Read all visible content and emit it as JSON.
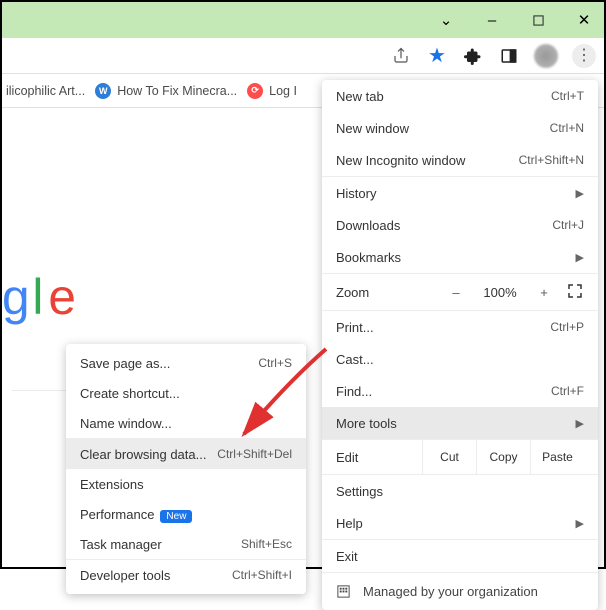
{
  "window": {
    "minimize": "–",
    "maximize": "▢",
    "close": "✕",
    "chevron": "⌄"
  },
  "bookmarks": {
    "item1": "ilicophilic Art...",
    "item2": "How To Fix Minecra...",
    "item3": "Log I"
  },
  "menu": {
    "newtab": {
      "label": "New tab",
      "shortcut": "Ctrl+T"
    },
    "newwindow": {
      "label": "New window",
      "shortcut": "Ctrl+N"
    },
    "incognito": {
      "label": "New Incognito window",
      "shortcut": "Ctrl+Shift+N"
    },
    "history": {
      "label": "History"
    },
    "downloads": {
      "label": "Downloads",
      "shortcut": "Ctrl+J"
    },
    "bookmarks": {
      "label": "Bookmarks"
    },
    "zoom": {
      "label": "Zoom",
      "minus": "–",
      "pct": "100%",
      "plus": "+"
    },
    "print": {
      "label": "Print...",
      "shortcut": "Ctrl+P"
    },
    "cast": {
      "label": "Cast..."
    },
    "find": {
      "label": "Find...",
      "shortcut": "Ctrl+F"
    },
    "moretools": {
      "label": "More tools"
    },
    "edit": {
      "label": "Edit",
      "cut": "Cut",
      "copy": "Copy",
      "paste": "Paste"
    },
    "settings": {
      "label": "Settings"
    },
    "help": {
      "label": "Help"
    },
    "exit": {
      "label": "Exit"
    },
    "managed": {
      "label": "Managed by your organization"
    }
  },
  "submenu": {
    "savepage": {
      "label": "Save page as...",
      "shortcut": "Ctrl+S"
    },
    "shortcut": {
      "label": "Create shortcut..."
    },
    "namewindow": {
      "label": "Name window..."
    },
    "cleardata": {
      "label": "Clear browsing data...",
      "shortcut": "Ctrl+Shift+Del"
    },
    "extensions": {
      "label": "Extensions"
    },
    "performance": {
      "label": "Performance",
      "badge": "New"
    },
    "taskmanager": {
      "label": "Task manager",
      "shortcut": "Shift+Esc"
    },
    "devtools": {
      "label": "Developer tools",
      "shortcut": "Ctrl+Shift+I"
    }
  }
}
